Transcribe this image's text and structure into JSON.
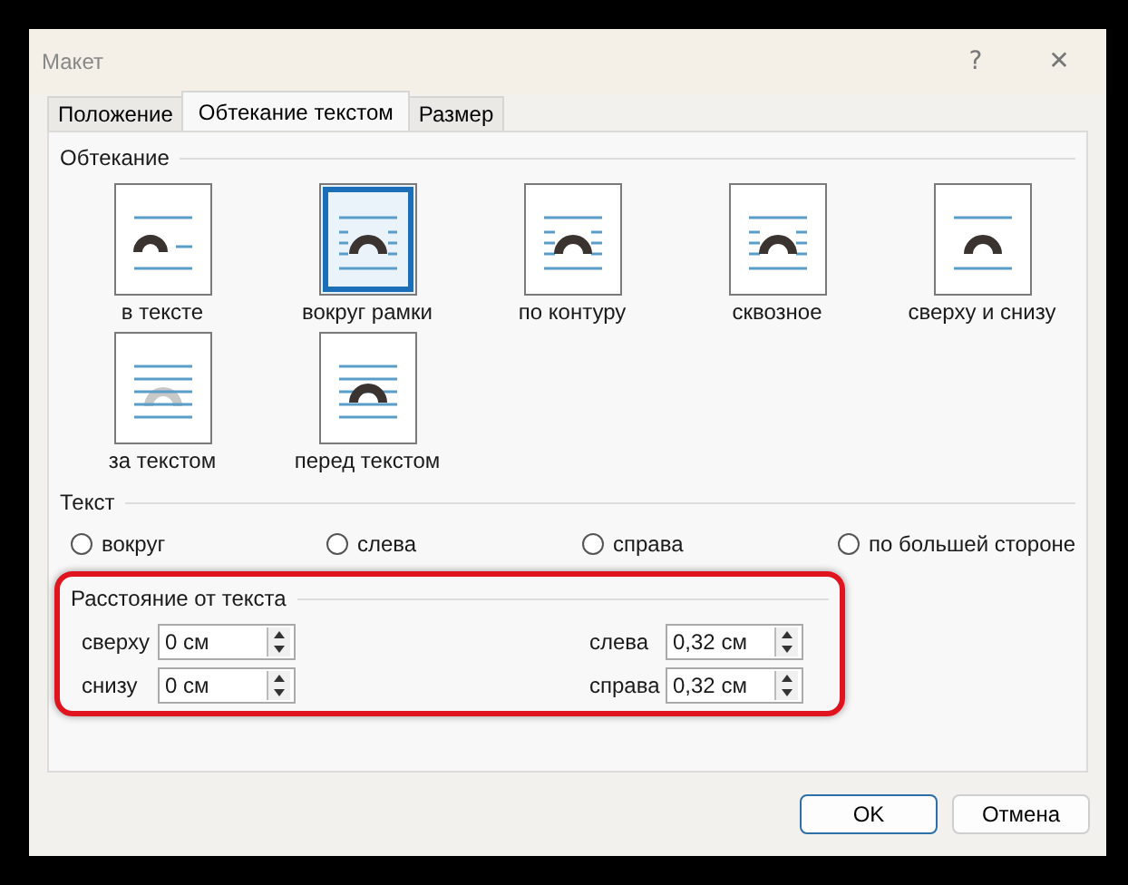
{
  "window": {
    "title": "Макет",
    "help": "?",
    "close": "✕"
  },
  "tabs": [
    {
      "label": "Положение",
      "selected": false
    },
    {
      "label": "Обтекание текстом",
      "selected": true
    },
    {
      "label": "Размер",
      "selected": false
    }
  ],
  "wrapping": {
    "title": "Обтекание",
    "options": [
      {
        "label": "в тексте",
        "kind": "inline",
        "selected": false
      },
      {
        "label": "вокруг рамки",
        "kind": "square",
        "selected": true
      },
      {
        "label": "по контуру",
        "kind": "tight",
        "selected": false
      },
      {
        "label": "сквозное",
        "kind": "through",
        "selected": false
      },
      {
        "label": "сверху и снизу",
        "kind": "topbottom",
        "selected": false
      },
      {
        "label": "за текстом",
        "kind": "behind",
        "selected": false
      },
      {
        "label": "перед текстом",
        "kind": "front",
        "selected": false
      }
    ]
  },
  "text": {
    "title": "Текст",
    "options": [
      {
        "label": "вокруг",
        "selected": false
      },
      {
        "label": "слева",
        "selected": false
      },
      {
        "label": "справа",
        "selected": false
      },
      {
        "label": "по большей стороне",
        "selected": false
      }
    ]
  },
  "distance": {
    "title": "Расстояние от текста",
    "highlighted": true,
    "fields": [
      {
        "label": "сверху",
        "value": "0 см"
      },
      {
        "label": "слева",
        "value": "0,32 см"
      },
      {
        "label": "снизу",
        "value": "0 см"
      },
      {
        "label": "справа",
        "value": "0,32 см"
      }
    ]
  },
  "buttons": [
    {
      "label": "OK",
      "kind": "default"
    },
    {
      "label": "Отмена",
      "kind": "normal"
    }
  ]
}
